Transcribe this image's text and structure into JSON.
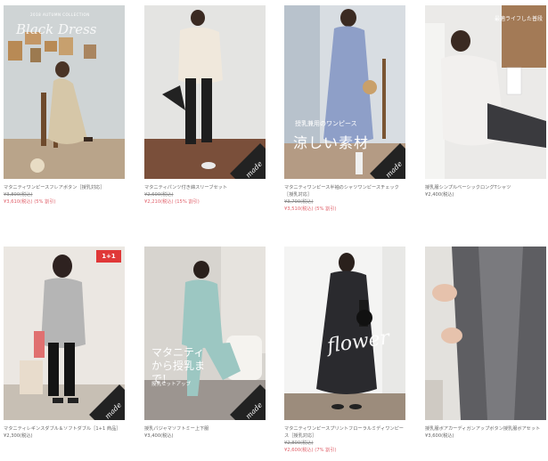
{
  "products": [
    {
      "name": "マタニティワンピースフレアボタン［授乳対応］",
      "price_original": "¥3,800(税込)",
      "price_sale": "¥3,610(税込) (5% 割引)",
      "overlay_small": "2018 AUTUMN COLLECTION",
      "overlay_title": "Black Dress"
    },
    {
      "name": "マタニティパンツ付き綿スリーブセット",
      "price_original": "¥2,600(税込)",
      "price_sale": "¥2,210(税込) (15% 割引)",
      "made_label": "made"
    },
    {
      "name": "マタニティワンピース半袖のシャツワンピースチェック［授乳対応］",
      "price_original": "¥3,700(税込)",
      "price_sale": "¥3,510(税込) (5% 割引)",
      "overlay_jp_small": "授乳兼用のワンピース",
      "overlay_jp_big": "涼しい素材",
      "made_label": "made"
    },
    {
      "name": "授乳服シンプルベーシックロングTシャツ",
      "price": "¥2,400(税込)",
      "overlay_corner": "最適ライフした普段"
    },
    {
      "name": "マタニティレギンスダブル＆ソフトダブル［1+1 商品］",
      "price": "¥2,300(税込)",
      "badge": "1+1",
      "made_label": "made"
    },
    {
      "name": "授乳パジャマソフトミー上下服",
      "price": "¥3,400(税込)",
      "overlay_jp_teal_big": "マタニティから授乳まで!",
      "overlay_jp_teal_small": "授乳セットアップ",
      "made_label": "made"
    },
    {
      "name": "マタニティワンピースプリントフローラルミディワンピース［授乳対応］",
      "price_original": "¥2,800(税込)",
      "price_sale": "¥2,600(税込) (7% 割引)",
      "overlay_flower": "flower"
    },
    {
      "name": "授乳服ボアカーディガンアップボタン授乳服ボアセット",
      "price": "¥3,600(税込)"
    }
  ],
  "colors": {
    "sale_price": "#e0606a",
    "badge_red": "#e03838",
    "made_badge": "#222222"
  }
}
